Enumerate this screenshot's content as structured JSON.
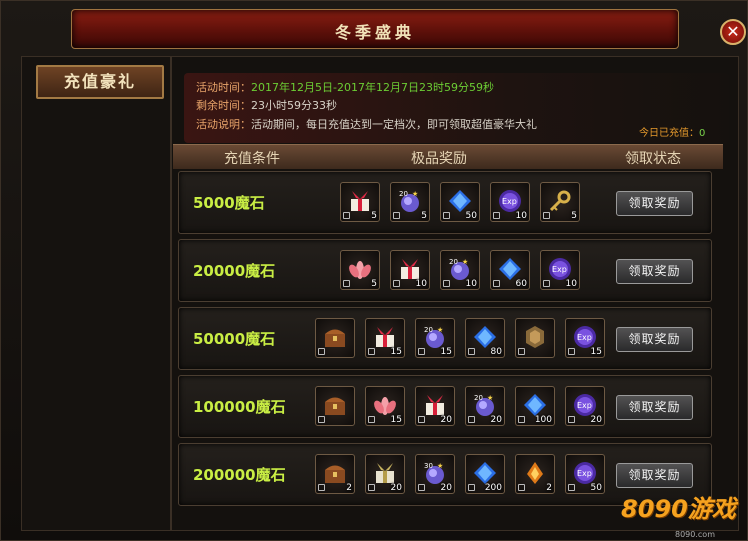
{
  "window": {
    "title": "冬季盛典",
    "close_icon": "close-icon"
  },
  "sidebar": {
    "tab": "充值豪礼"
  },
  "info": {
    "time_label": "活动时间：",
    "time_value": "2017年12月5日-2017年12月7日23时59分59秒",
    "remaining_label": "剩余时间：",
    "remaining_value": "23小时59分33秒",
    "desc_label": "活动说明：",
    "desc_value": "活动期间，每日充值达到一定档次，即可领取超值豪华大礼",
    "today_label": "今日已充值：",
    "today_value": "0"
  },
  "table": {
    "col_condition": "充值条件",
    "col_reward": "极品奖励",
    "col_status": "领取状态"
  },
  "tiers": [
    {
      "condition": "5000魔石",
      "button": "领取奖励",
      "items": [
        {
          "icon": "gift-box-icon",
          "count": "5"
        },
        {
          "icon": "soul-orb-20-icon",
          "count": "5"
        },
        {
          "icon": "blue-gem-icon",
          "count": "50"
        },
        {
          "icon": "exp-orb-icon",
          "count": "10"
        },
        {
          "icon": "treasure-key-icon",
          "count": "5"
        }
      ]
    },
    {
      "condition": "20000魔石",
      "button": "领取奖励",
      "items": [
        {
          "icon": "lotus-icon",
          "count": "5"
        },
        {
          "icon": "gift-box-icon",
          "count": "10"
        },
        {
          "icon": "soul-orb-20-icon",
          "count": "10"
        },
        {
          "icon": "blue-gem-icon",
          "count": "60"
        },
        {
          "icon": "exp-orb-icon",
          "count": "10"
        }
      ]
    },
    {
      "condition": "50000魔石",
      "button": "领取奖励",
      "items": [
        {
          "icon": "treasure-chest-icon",
          "count": ""
        },
        {
          "icon": "gift-box-icon",
          "count": "15"
        },
        {
          "icon": "soul-orb-20-icon",
          "count": "15"
        },
        {
          "icon": "blue-gem-icon",
          "count": "80"
        },
        {
          "icon": "bronze-token-icon",
          "count": ""
        },
        {
          "icon": "exp-orb-icon",
          "count": "15"
        }
      ]
    },
    {
      "condition": "100000魔石",
      "button": "领取奖励",
      "items": [
        {
          "icon": "treasure-chest-icon",
          "count": ""
        },
        {
          "icon": "lotus-icon",
          "count": "15"
        },
        {
          "icon": "gift-box-icon",
          "count": "20"
        },
        {
          "icon": "soul-orb-20-icon",
          "count": "20"
        },
        {
          "icon": "blue-gem-icon",
          "count": "100"
        },
        {
          "icon": "exp-orb-icon",
          "count": "20"
        }
      ]
    },
    {
      "condition": "200000魔石",
      "button": "领取奖励",
      "items": [
        {
          "icon": "treasure-chest-icon",
          "count": "2"
        },
        {
          "icon": "gold-gift-icon",
          "count": "20"
        },
        {
          "icon": "soul-orb-30-icon",
          "count": "20"
        },
        {
          "icon": "blue-gem-icon",
          "count": "200"
        },
        {
          "icon": "flame-crystal-icon",
          "count": "2"
        },
        {
          "icon": "exp-orb-icon",
          "count": "50"
        }
      ]
    }
  ],
  "watermark": {
    "logo": "8090游戏",
    "url": "8090.com"
  }
}
